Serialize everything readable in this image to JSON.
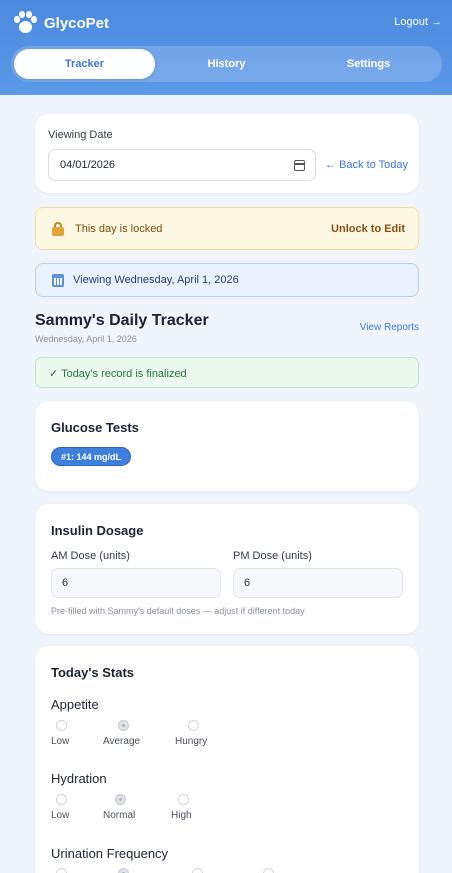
{
  "app": {
    "name": "GlycoPet",
    "logout_label": "Logout →"
  },
  "tabs": [
    {
      "label": "Tracker",
      "active": true
    },
    {
      "label": "History",
      "active": false
    },
    {
      "label": "Settings",
      "active": false
    }
  ],
  "date_card": {
    "label": "Viewing Date",
    "value": "04/01/2026",
    "back_label": "← Back to Today"
  },
  "lock_banner": {
    "text": "This day is locked",
    "action": "Unlock to Edit"
  },
  "viewing_banner": {
    "text": "Viewing Wednesday, April 1, 2026"
  },
  "tracker": {
    "title": "Sammy's Daily Tracker",
    "subtitle": "Wednesday, April 1, 2026",
    "reports_link": "View Reports"
  },
  "finalized": {
    "text": "✓ Today's record is finalized"
  },
  "glucose": {
    "title": "Glucose Tests",
    "tests": [
      "#1: 144 mg/dL"
    ]
  },
  "insulin": {
    "title": "Insulin Dosage",
    "am_label": "AM Dose (units)",
    "am_value": "6",
    "pm_label": "PM Dose (units)",
    "pm_value": "6",
    "helper": "Pre-filled with Sammy's default doses — adjust if different today"
  },
  "stats": {
    "title": "Today's Stats",
    "appetite": {
      "label": "Appetite",
      "options": [
        "Low",
        "Average",
        "Hungry"
      ],
      "selected": "Average"
    },
    "hydration": {
      "label": "Hydration",
      "options": [
        "Low",
        "Normal",
        "High"
      ],
      "selected": "Normal"
    },
    "urination": {
      "label": "Urination Frequency"
    }
  },
  "colors": {
    "accent": "#4c8ae0",
    "lock_bg": "#fdf8e2",
    "final_bg": "#ecf9ef"
  }
}
